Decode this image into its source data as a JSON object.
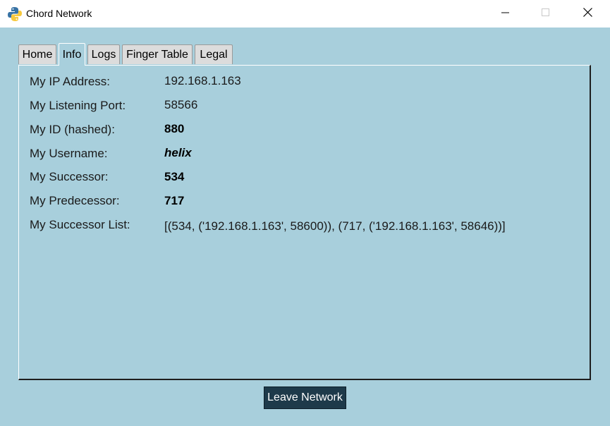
{
  "window": {
    "title": "Chord Network",
    "app_icon": "python-icon"
  },
  "tabs": [
    {
      "label": "Home",
      "active": false
    },
    {
      "label": "Info",
      "active": true
    },
    {
      "label": "Logs",
      "active": false
    },
    {
      "label": "Finger Table",
      "active": false
    },
    {
      "label": "Legal",
      "active": false
    }
  ],
  "info": {
    "ip_label": "My IP Address:",
    "ip_value": "192.168.1.163",
    "port_label": "My Listening Port:",
    "port_value": "58566",
    "id_label": "My ID (hashed):",
    "id_value": "880",
    "username_label": "My Username:",
    "username_value": "helix",
    "successor_label": "My Successor:",
    "successor_value": "534",
    "predecessor_label": "My Predecessor:",
    "predecessor_value": "717",
    "successor_list_label": "My Successor List:",
    "successor_list_value": "[(534, ('192.168.1.163', 58600)), (717, ('192.168.1.163', 58646))]"
  },
  "actions": {
    "leave_label": "Leave Network"
  },
  "colors": {
    "background": "#a8cfdc",
    "button": "#1e3a4a"
  }
}
